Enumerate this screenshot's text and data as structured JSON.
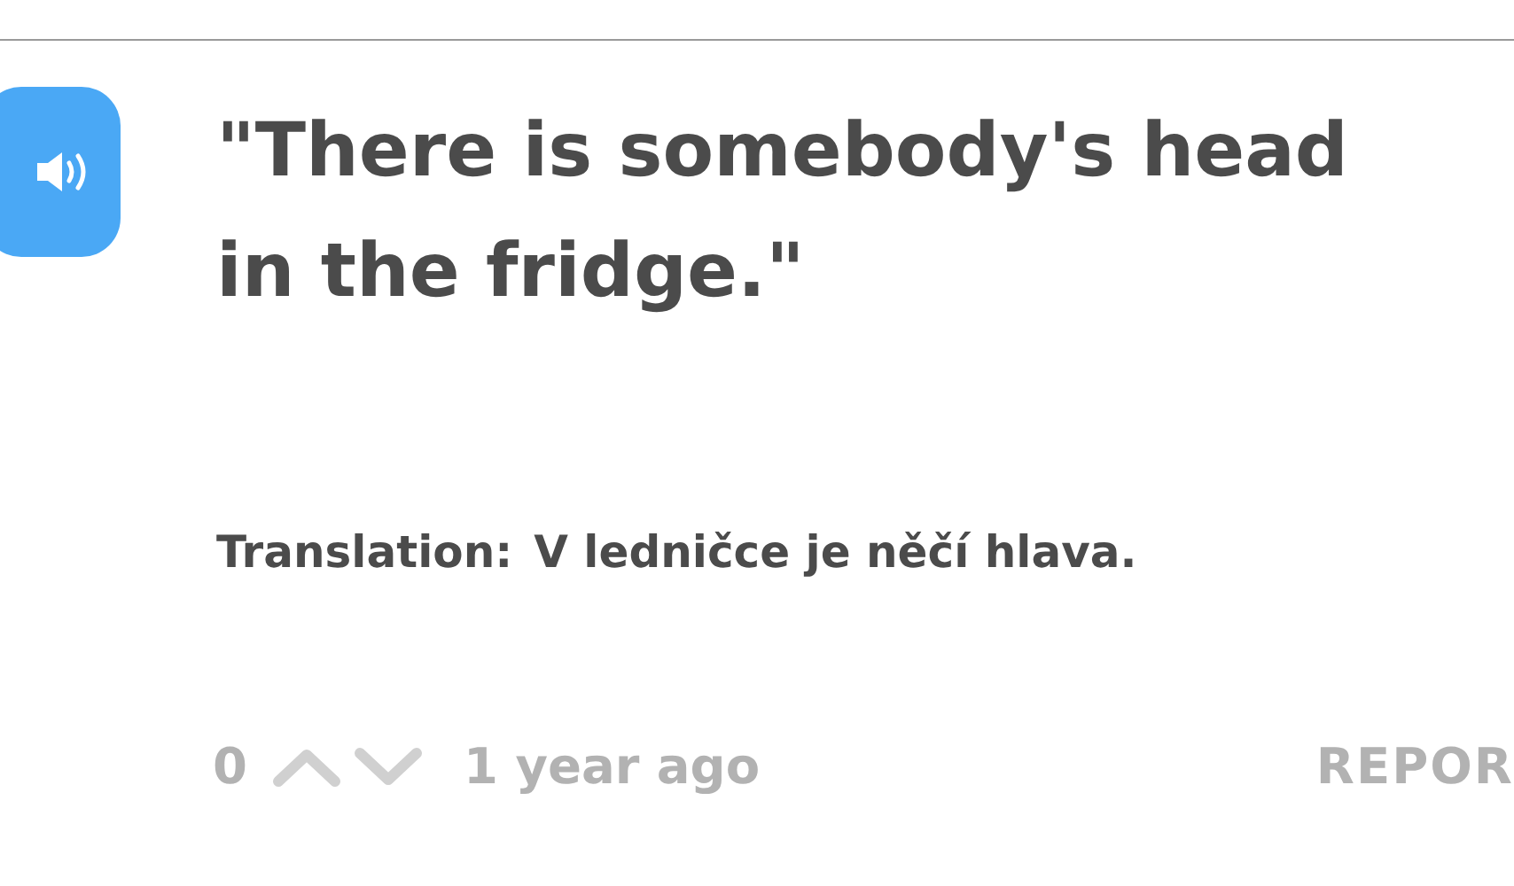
{
  "sentence": {
    "text": "\"There is somebody's head in the fridge.\""
  },
  "translation": {
    "label": "Translation:",
    "text": "V ledničce je něčí hlava."
  },
  "footer": {
    "votes": "0",
    "time": "1 year ago",
    "report": "REPOR"
  }
}
